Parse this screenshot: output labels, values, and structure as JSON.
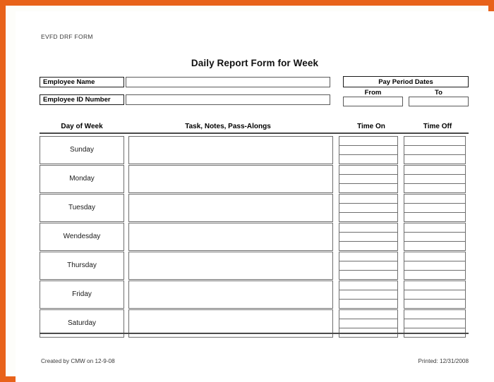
{
  "document": {
    "form_code": "EVFD DRF FORM",
    "title": "Daily Report Form for Week"
  },
  "employee": {
    "name_label": "Employee Name",
    "name_value": "",
    "id_label": "Employee ID Number",
    "id_value": ""
  },
  "pay_period": {
    "header": "Pay Period Dates",
    "from_label": "From",
    "from_value": "",
    "to_label": "To",
    "to_value": ""
  },
  "table": {
    "headers": {
      "day": "Day of Week",
      "task": "Task, Notes, Pass-Alongs",
      "time_on": "Time On",
      "time_off": "Time Off"
    },
    "rows": [
      {
        "day": "Sunday",
        "task": "",
        "time_on": [
          "",
          "",
          ""
        ],
        "time_off": [
          "",
          "",
          ""
        ]
      },
      {
        "day": "Monday",
        "task": "",
        "time_on": [
          "",
          "",
          ""
        ],
        "time_off": [
          "",
          "",
          ""
        ]
      },
      {
        "day": "Tuesday",
        "task": "",
        "time_on": [
          "",
          "",
          ""
        ],
        "time_off": [
          "",
          "",
          ""
        ]
      },
      {
        "day": "Wendesday",
        "task": "",
        "time_on": [
          "",
          "",
          ""
        ],
        "time_off": [
          "",
          "",
          ""
        ]
      },
      {
        "day": "Thursday",
        "task": "",
        "time_on": [
          "",
          "",
          ""
        ],
        "time_off": [
          "",
          "",
          ""
        ]
      },
      {
        "day": "Friday",
        "task": "",
        "time_on": [
          "",
          "",
          ""
        ],
        "time_off": [
          "",
          "",
          ""
        ]
      },
      {
        "day": "Saturday",
        "task": "",
        "time_on": [
          "",
          "",
          ""
        ],
        "time_off": [
          "",
          "",
          ""
        ]
      }
    ]
  },
  "footer": {
    "created": "Created by CMW on 12-9-08",
    "printed": "Printed: 12/31/2008"
  },
  "colors": {
    "border_accent": "#e8621a",
    "rule": "#4a4a4a",
    "cell_border": "#6e6e6e"
  }
}
